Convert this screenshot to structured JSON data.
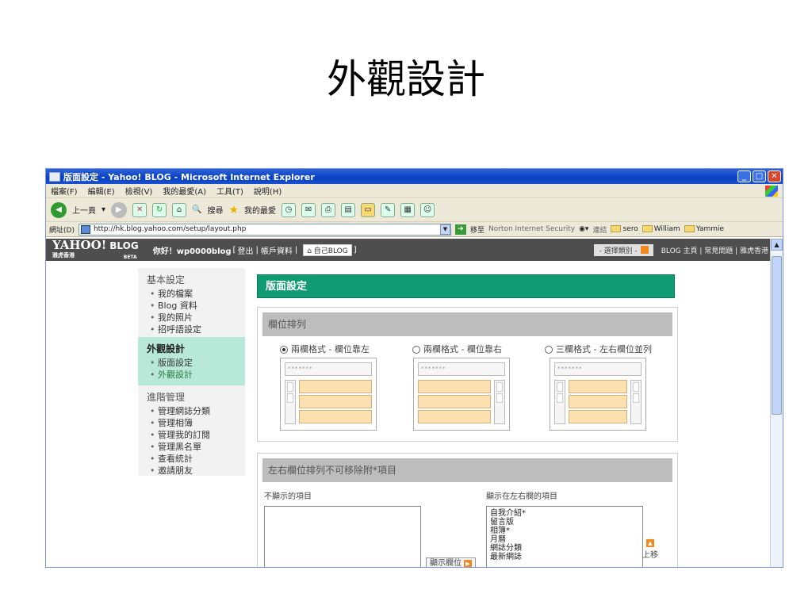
{
  "slide": {
    "title": "外觀設計"
  },
  "window": {
    "title": "版面設定 - Yahoo! BLOG - Microsoft Internet Explorer"
  },
  "menu": [
    "檔案(F)",
    "編輯(E)",
    "檢視(V)",
    "我的最愛(A)",
    "工具(T)",
    "說明(H)"
  ],
  "toolbar": {
    "back": "上一頁",
    "search": "搜尋",
    "favorites": "我的最愛"
  },
  "address": {
    "label": "網址(D)",
    "url": "http://hk.blog.yahoo.com/setup/layout.php",
    "go": "移至",
    "norton": "Norton Internet Security",
    "links_label": "連結",
    "links": [
      "sero",
      "William",
      "Yammie"
    ]
  },
  "yahoo": {
    "logo": "YAHOO!",
    "logo_sub": "雅虎香港",
    "blog": "BLOG",
    "beta": "BETA",
    "greeting": "你好！wp0000blog",
    "logout_prefix": "[",
    "logout": "登出",
    "sep": "|",
    "account": "帳戶資料",
    "myblog": "自己BLOG",
    "close_bracket": "]",
    "select_category": "- 選擇類別 -",
    "top_links": "BLOG 主頁 | 常見問題 | 雅虎香港"
  },
  "sidebar": {
    "groups": [
      {
        "title": "基本設定",
        "items": [
          "我的檔案",
          "Blog 資料",
          "我的照片",
          "招呼語設定"
        ]
      },
      {
        "title": "外觀設計",
        "items": [
          "版面設定",
          "外觀設計"
        ]
      },
      {
        "title": "進階管理",
        "items": [
          "管理網誌分類",
          "管理相簿",
          "管理我的訂閱",
          "管理黑名單",
          "查看統計",
          "邀請朋友"
        ]
      }
    ]
  },
  "main": {
    "title": "版面設定",
    "layout_section": {
      "header": "欄位排列",
      "options": [
        "兩欄格式 - 欄位靠左",
        "兩欄格式 - 欄位靠右",
        "三欄格式 - 左右欄位並列"
      ],
      "selected_index": 0,
      "placeholder": "*******"
    },
    "columns_section": {
      "header": "左右欄位排列不可移除附*項目",
      "hidden_label": "不顯示的項目",
      "shown_label": "顯示在左右欄的項目",
      "shown_items": [
        "自我介紹*",
        "留言版",
        "相簿*",
        "月曆",
        "網誌分類",
        "最新網誌"
      ],
      "show_button": "顯示欄位",
      "move_up": "上移"
    }
  }
}
